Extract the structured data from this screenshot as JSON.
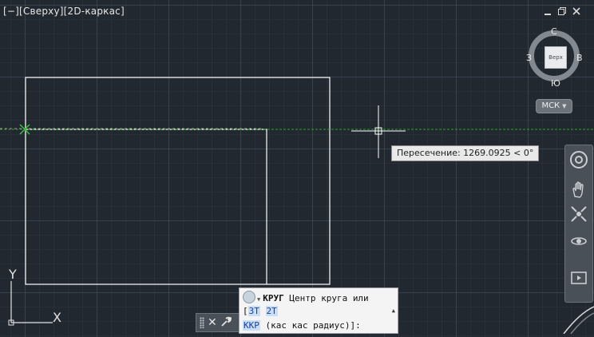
{
  "viewport": {
    "label": "[−][Сверху][2D-каркас]"
  },
  "window_controls": {
    "minimize_icon": "minimize-icon",
    "restore_icon": "restore-icon",
    "close_icon": "close-icon"
  },
  "viewcube": {
    "north": "С",
    "south": "Ю",
    "west": "З",
    "east": "В",
    "face": "Верх"
  },
  "ucs_menu": {
    "label": "МСК"
  },
  "navbar": {
    "tools": [
      "steering-wheel-icon",
      "pan-icon",
      "zoom-extents-icon",
      "orbit-icon",
      "showmotion-icon"
    ]
  },
  "tooltip": {
    "text": "Пересечение: 1269.0925 < 0°"
  },
  "command": {
    "name": "КРУГ",
    "prompt": "Центр круга или",
    "open_bracket": "[",
    "option_3t": "3Т",
    "option_2t": "2Т",
    "option_kkr": "ККР",
    "tail": "(кас кас радиус)]:"
  },
  "ucs_icon": {
    "y_label": "Y",
    "x_label": "X"
  },
  "colors": {
    "background": "#212830",
    "geometry": "#ffffff",
    "tracking_line": "#2aa52a",
    "osnap_marker": "#3fbf3f"
  }
}
